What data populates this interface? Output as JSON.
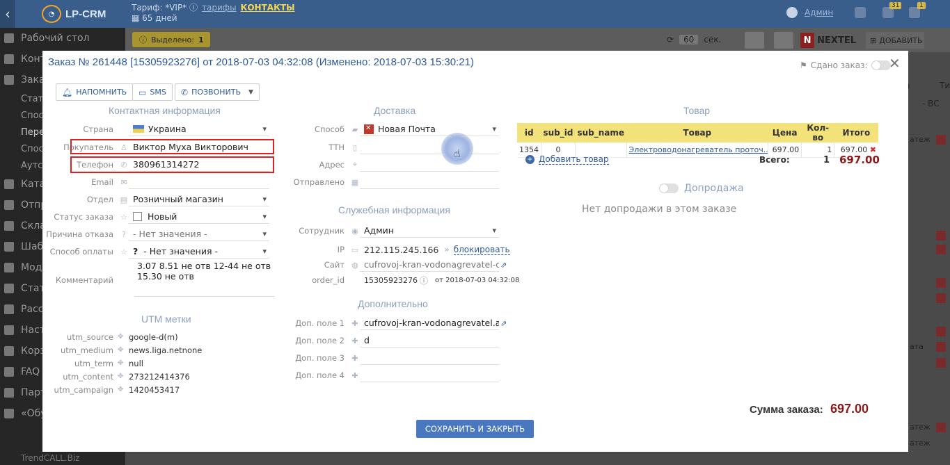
{
  "app": {
    "logo_text": "LP-CRM",
    "tariff_line": "Тариф: *VIP*",
    "tariff_link": "тарифы",
    "contacts_link": "КОНТАКТЫ",
    "days_left": "65 дней",
    "user_name": "Админ",
    "badge_1": "31",
    "badge_2": "1"
  },
  "sidebar": {
    "items": [
      {
        "label": "Рабочий стол"
      },
      {
        "label": "Конт"
      },
      {
        "label": "Зака"
      },
      {
        "label": "Стату"
      },
      {
        "label": "Спос"
      },
      {
        "label": "Пере"
      },
      {
        "label": "Спос"
      },
      {
        "label": "Аутсо"
      },
      {
        "label": "Ката"
      },
      {
        "label": "Отпр"
      },
      {
        "label": "Скла"
      },
      {
        "label": "Шаб"
      },
      {
        "label": "Моду"
      },
      {
        "label": "Стат"
      },
      {
        "label": "Расс"
      },
      {
        "label": "Наст"
      },
      {
        "label": "Корз"
      },
      {
        "label": "FAQ"
      },
      {
        "label": "Парт"
      },
      {
        "label": "«Обу"
      }
    ]
  },
  "toolbar": {
    "selected_label": "Выделено:",
    "selected_count": "1",
    "refresh_value": "60",
    "refresh_unit": "сек.",
    "nextel": "NEXTEL",
    "add_label": "ДОБАВИТЬ"
  },
  "background": {
    "col_t": "а",
    "col_ti": "Ти",
    "dropdown": "- ВС",
    "row_text_1": "атеж",
    "row_text_2": "ата",
    "row_text_3": "атеж",
    "row_text_4": "атеж",
    "footer_text": "TrendCALL.Biz"
  },
  "modal": {
    "title": "Заказ № 261448 [15305923276] от 2018-07-03 04:32:08 (Изменено: 2018-07-03 15:30:21)",
    "done_label": "Сдано заказ:",
    "buttons": {
      "remind": "НАПОМНИТЬ",
      "sms": "SMS",
      "call": "ПОЗВОНИТЬ"
    },
    "contact": {
      "title": "Контактная информация",
      "country_label": "Страна",
      "country": "Украина",
      "buyer_label": "Покупатель",
      "buyer": "Виктор  Муха  Викторович",
      "phone_label": "Телефон",
      "phone": "380961314272",
      "email_label": "Email",
      "email": "",
      "dept_label": "Отдел",
      "dept": "Розничный магазин",
      "status_label": "Статус заказа",
      "status": "Новый",
      "reason_label": "Причина отказа",
      "reason": "- Нет значения -",
      "payment_label": "Способ оплаты",
      "payment": "- Нет значения -",
      "comment_label": "Комментарий",
      "comment": "3.07 8.51 не отв 12-44 не отв 15.30 не отв"
    },
    "utm": {
      "title": "UTM метки",
      "rows": [
        {
          "k": "utm_source",
          "v": "google-d(m)"
        },
        {
          "k": "utm_medium",
          "v": "news.liga.netnone"
        },
        {
          "k": "utm_term",
          "v": "null"
        },
        {
          "k": "utm_content",
          "v": "273212414376"
        },
        {
          "k": "utm_campaign",
          "v": "1420453417"
        }
      ]
    },
    "delivery": {
      "title": "Доставка",
      "method_label": "Способ",
      "method": "Новая Почта",
      "ttn_label": "ТТН",
      "address_label": "Адрес",
      "sent_label": "Отправлено"
    },
    "service": {
      "title": "Служебная информация",
      "employee_label": "Сотрудник",
      "employee": "Админ",
      "ip_label": "IP",
      "ip": "212.115.245.166",
      "block_link": "блокировать",
      "site_label": "Сайт",
      "site": "cufrovoj-kran-vodonagrevatel-d.ast",
      "order_id_label": "order_id",
      "order_id": "15305923276",
      "order_date": "от 2018-07-03 04:32:08"
    },
    "extra": {
      "title": "Дополнительно",
      "f1_label": "Доп. поле 1",
      "f1": "cufrovoj-kran-vodonagrevatel.astar",
      "f2_label": "Доп. поле 2",
      "f2": "d",
      "f3_label": "Доп. поле 3",
      "f4_label": "Доп. поле 4"
    },
    "goods": {
      "title": "Товар",
      "headers": [
        "id",
        "sub_id",
        "sub_name",
        "Товар",
        "Цена",
        "Кол-во",
        "Итого"
      ],
      "row": {
        "id": "1354",
        "sub_id": "0",
        "sub_name": "",
        "name": "Электроводонагреватель проточ...",
        "price": "697.00",
        "qty": "1",
        "total": "697.00"
      },
      "add_label": "Добавить товар",
      "total_label": "Всего:",
      "total_qty": "1",
      "total_sum": "697.00"
    },
    "upsell": {
      "title": "Допродажа",
      "empty": "Нет допродажи в этом заказе"
    },
    "sum_label": "Сумма заказа:",
    "sum_value": "697.00",
    "save_button": "СОХРАНИТЬ И ЗАКРЫТЬ"
  }
}
